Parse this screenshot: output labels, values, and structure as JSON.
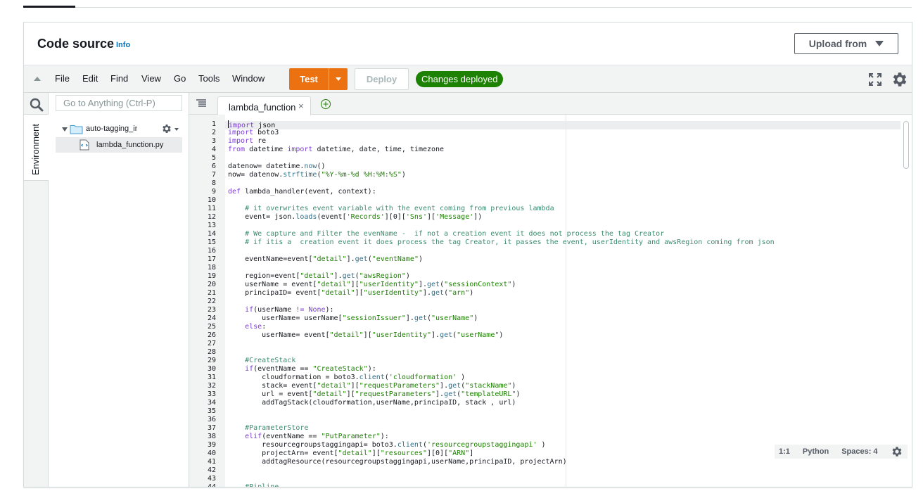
{
  "header": {
    "title": "Code source",
    "info_link": "Info",
    "upload_label": "Upload from"
  },
  "toolbar": {
    "menus": [
      "File",
      "Edit",
      "Find",
      "View",
      "Go",
      "Tools",
      "Window"
    ],
    "test_label": "Test",
    "deploy_label": "Deploy",
    "status_badge": "Changes deployed"
  },
  "sidebar": {
    "search_placeholder": "Go to Anything (Ctrl-P)",
    "environment_tab": "Environment",
    "folder_name": "auto-tagging_in_serverless",
    "file_name": "lambda_function.py"
  },
  "editor": {
    "tab_label": "lambda_function",
    "status": {
      "position": "1:1",
      "language": "Python",
      "spaces": "Spaces: 4"
    }
  },
  "colors": {
    "test_orange": "#ec7211",
    "deployed_green": "#1d8102",
    "info_blue": "#0073bb",
    "keyword": "#7c3bd6",
    "string": "#1d8102"
  },
  "code_lines": [
    "import json",
    "import boto3",
    "import re",
    "from datetime import datetime, date, time, timezone",
    "",
    "datenow= datetime.now()",
    "now= datenow.strftime(\"%Y-%m-%d %H:%M:%S\")",
    "",
    "def lambda_handler(event, context):",
    "",
    "    # it overwrites event variable with the event coming from previous lambda",
    "    event= json.loads(event['Records'][0]['Sns']['Message'])",
    "",
    "    # We capture and Filter the evenName -  if not a creation event it does not process the tag Creator",
    "    # if itis a  creation event it does process the tag Creator, it passes the event, userIdentity and awsRegion coming from json",
    "",
    "    eventName=event[\"detail\"].get(\"eventName\")",
    "",
    "    region=event[\"detail\"].get(\"awsRegion\")",
    "    userName = event[\"detail\"][\"userIdentity\"].get(\"sessionContext\")",
    "    principaID= event[\"detail\"][\"userIdentity\"].get(\"arn\")",
    "",
    "    if(userName != None):",
    "        userName= userName[\"sessionIssuer\"].get(\"userName\")",
    "    else:",
    "        userName= event[\"detail\"][\"userIdentity\"].get(\"userName\")",
    "",
    "",
    "    #CreateStack",
    "    if(eventName == \"CreateStack\"):",
    "        cloudformation = boto3.client('cloudformation' )",
    "        stack= event[\"detail\"][\"requestParameters\"].get(\"stackName\")",
    "        url = event[\"detail\"][\"requestParameters\"].get(\"templateURL\")",
    "        addTagStack(cloudformation,userName,principaID, stack , url)",
    "",
    "",
    "    #ParameterStore",
    "    elif(eventName == \"PutParameter\"):",
    "        resourcegroupstaggingapi= boto3.client('resourcegroupstaggingapi' )",
    "        projectArn= event[\"detail\"][\"resources\"][0][\"ARN\"]",
    "        addtagResource(resourcegroupstaggingapi,userName,principaID, projectArn)",
    "",
    "",
    "    #Pipline"
  ]
}
